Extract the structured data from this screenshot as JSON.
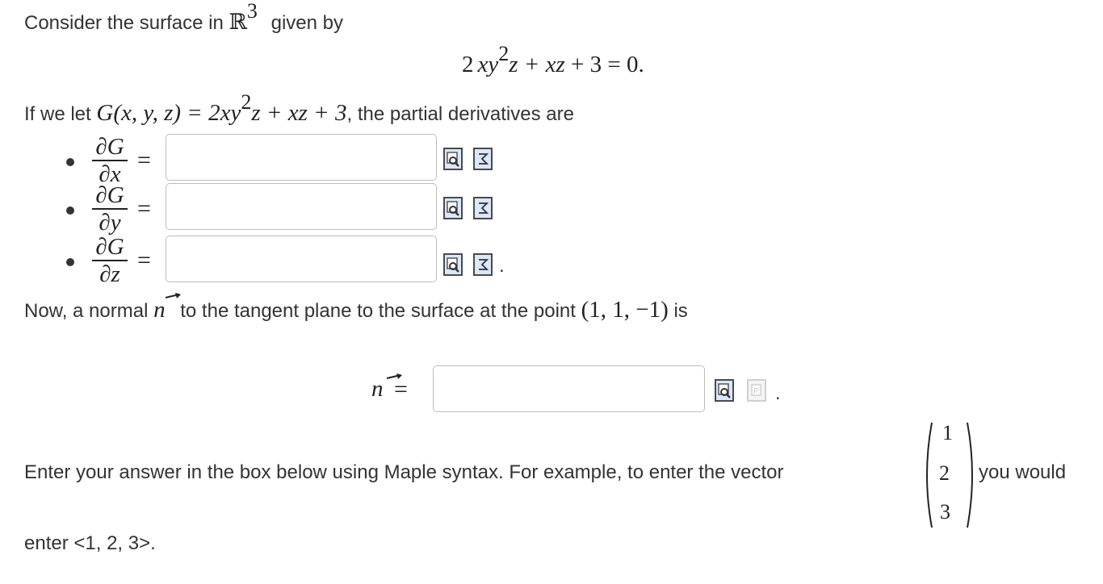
{
  "intro": {
    "prefix": "Consider the surface in ",
    "space": "ℝ",
    "space_exp": "3",
    "suffix": "given by"
  },
  "equation": {
    "lhs_a": "2",
    "lhs_b": "xy",
    "lhs_exp": "2",
    "lhs_c": "z + ",
    "lhs_d": "xz",
    "lhs_e": " + 3 = 0."
  },
  "define": {
    "prefix": "If we let ",
    "func": "G(x, y, z) = 2",
    "xy": "xy",
    "exp": "2",
    "rest": "z + xz + 3",
    "suffix": ", the partial derivatives are"
  },
  "partials": [
    {
      "num": "∂G",
      "den": "∂x",
      "eq": "=",
      "value": ""
    },
    {
      "num": "∂G",
      "den": "∂y",
      "eq": "=",
      "value": ""
    },
    {
      "num": "∂G",
      "den": "∂z",
      "eq": "=",
      "value": ""
    }
  ],
  "trailing_period": ".",
  "normal": {
    "prefix": "Now, a normal",
    "symbol": "n",
    "middle": "to the tangent plane to the surface at the point",
    "point": "(1, 1, −1)",
    "suffix": "is",
    "answer_label": "n",
    "answer_eq": "=",
    "answer_value": ""
  },
  "instructions": {
    "text": "Enter your answer in the box below using Maple syntax.  For example, to enter the vector",
    "vector": [
      "1",
      "2",
      "3"
    ],
    "after": "you would",
    "last_line": "enter <1, 2, 3>."
  },
  "icons": {
    "preview": "preview-icon",
    "equation_editor": "equation-editor-icon",
    "plot_disabled": "plot-icon"
  }
}
